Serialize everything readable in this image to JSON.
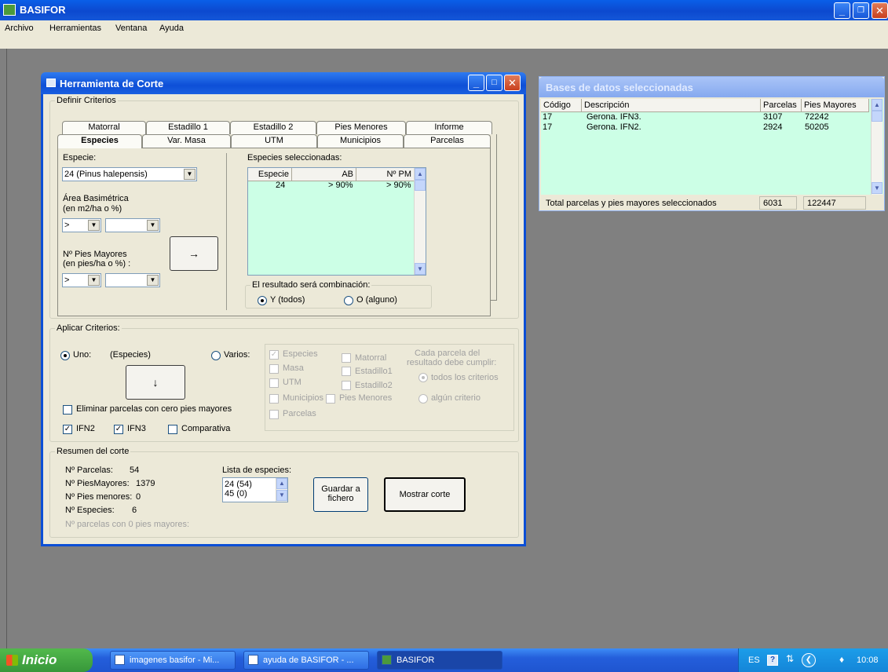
{
  "app": {
    "title": "BASIFOR"
  },
  "menubar": [
    "Archivo",
    "Herramientas",
    "Ventana",
    "Ayuda"
  ],
  "corte": {
    "title": "Herramienta de Corte",
    "definir": "Definir Criterios",
    "tabs_back": [
      "Matorral",
      "Estadillo 1",
      "Estadillo 2",
      "Pies Menores",
      "Informe"
    ],
    "tabs_front": [
      "Especies",
      "Var. Masa",
      "UTM",
      "Municipios",
      "Parcelas"
    ],
    "especie_label": "Especie:",
    "especie_value": "24 (Pinus halepensis)",
    "area_label_1": "Área Basimétrica",
    "area_label_2": "(en m2/ha  o  %)",
    "op_value": ">",
    "pies_label_1": "Nº Pies Mayores",
    "pies_label_2": "(en pies/ha  o  %) :",
    "add_arrow": "→",
    "sel_label": "Especies seleccionadas:",
    "sel_cols": [
      "Especie",
      "AB",
      "Nº PM"
    ],
    "sel_row": [
      "24",
      "> 90%",
      "> 90%"
    ],
    "comb_label": "El resultado será combinación:",
    "comb_y": "Y (todos)",
    "comb_o": "O (alguno)",
    "aplicar": "Aplicar Criterios:",
    "uno_label": "Uno:",
    "uno_value": "(Especies)",
    "varios_label": "Varios:",
    "down_arrow": "↓",
    "chk_especies": "Especies",
    "chk_matorral": "Matorral",
    "chk_masa": "Masa",
    "chk_estadillo1": "Estadillo1",
    "chk_utm": "UTM",
    "chk_estadillo2": "Estadillo2",
    "chk_municipios": "Municipios",
    "chk_pies_menores": "Pies Menores",
    "chk_parcelas": "Parcelas",
    "cada_1": "Cada parcela del",
    "cada_2": "resultado debe cumplir:",
    "todos_crit": "todos los criterios",
    "algun_crit": "algún criterio",
    "eliminar": "Eliminar parcelas con cero pies mayores",
    "ifn2": "IFN2",
    "ifn3": "IFN3",
    "comparativa": "Comparativa",
    "resumen": "Resumen del corte",
    "r_parcelas_l": "Nº Parcelas:",
    "r_parcelas_v": "54",
    "r_pm_l": "Nº PiesMayores:",
    "r_pm_v": "1379",
    "r_pmen_l": "Nº Pies menores:",
    "r_pmen_v": "0",
    "r_esp_l": "Nº Especies:",
    "r_esp_v": "6",
    "r_cero": "Nº parcelas con 0 pies mayores:",
    "lista_label": "Lista de especies:",
    "lista_items": [
      "24 (54)",
      "45 (0)"
    ],
    "guardar_1": "Guardar a",
    "guardar_2": "fichero",
    "mostrar": "Mostrar corte"
  },
  "bases": {
    "title": "Bases de datos seleccionadas",
    "cols": [
      "Código",
      "Descripción",
      "Parcelas",
      "Pies Mayores"
    ],
    "rows": [
      {
        "codigo": "17",
        "desc": "Gerona. IFN3.",
        "parcelas": "3107",
        "pies": "72242"
      },
      {
        "codigo": "17",
        "desc": "Gerona. IFN2.",
        "parcelas": "2924",
        "pies": "50205"
      }
    ],
    "total_label": "Total parcelas y pies mayores seleccionados",
    "total_parcelas": "6031",
    "total_pies": "122447"
  },
  "taskbar": {
    "start": "Inicio",
    "items": [
      "imagenes basifor - Mi...",
      "ayuda de BASIFOR - ...",
      "BASIFOR"
    ],
    "lang": "ES",
    "time": "10:08"
  }
}
